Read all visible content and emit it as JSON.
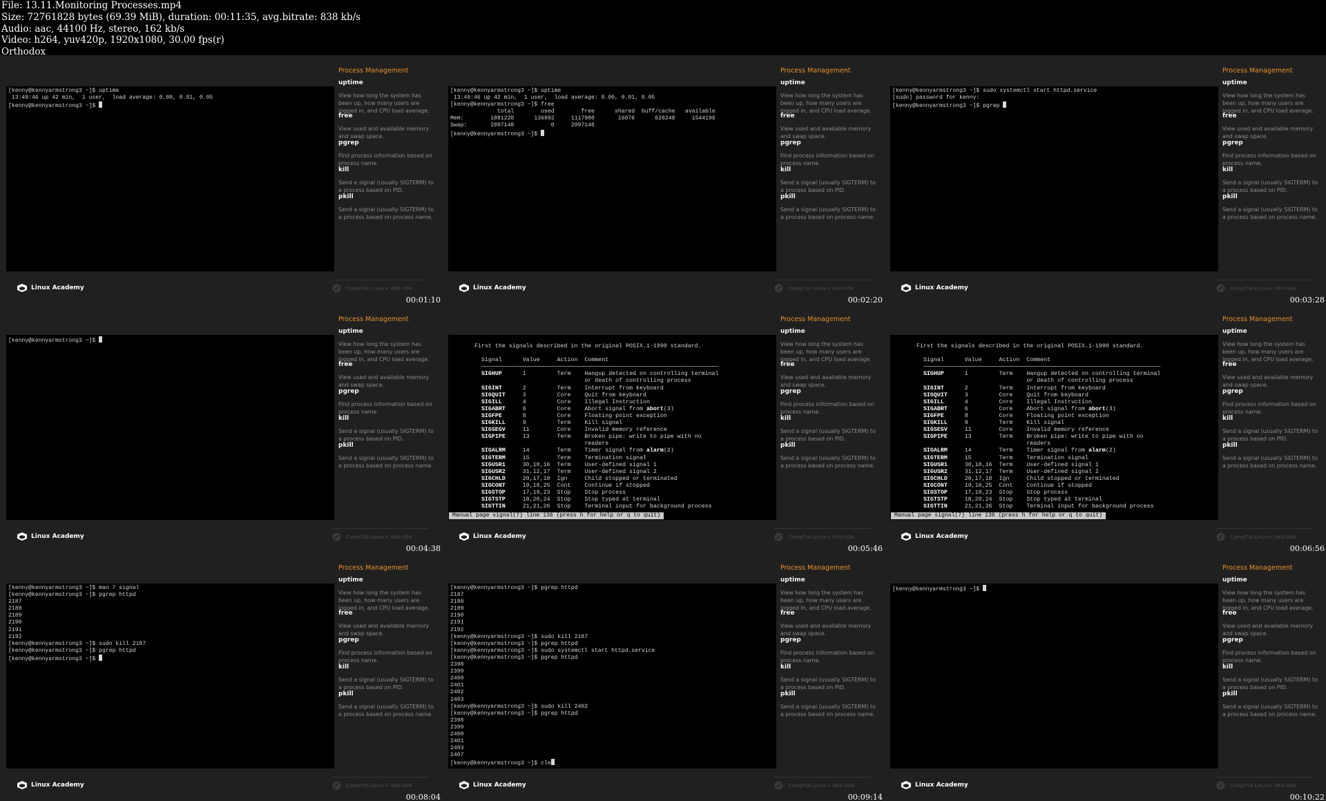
{
  "header": {
    "lines": [
      "File: 13.11.Monitoring Processes.mp4",
      "Size: 72761828 bytes (69.39 MiB), duration: 00:11:35, avg.bitrate: 838 kb/s",
      "Audio: aac, 44100 Hz, stereo, 162 kb/s",
      "Video: h264, yuv420p, 1920x1080, 30.00 fps(r)",
      "Orthodox"
    ]
  },
  "sidebar": {
    "title": "Process Management",
    "items": [
      {
        "name": "uptime",
        "desc": "View how long the system has been up, how many users are logged in, and CPU load average."
      },
      {
        "name": "free",
        "desc": "View used and available memory and swap space."
      },
      {
        "name": "pgrep",
        "desc": "Find process information based on process name."
      },
      {
        "name": "kill",
        "desc": "Send a signal (usually SIGTERM) to a process based on PID."
      },
      {
        "name": "pkill",
        "desc": "Send a signal (usually SIGTERM) to a process based on process name."
      }
    ]
  },
  "footer": {
    "logo_text": "Linux Academy",
    "course_text": "CompTIA Linux+ XK0-004",
    "logo_icon": "linux-academy-cube-icon",
    "course_icon": "comptia-badge-icon"
  },
  "manpage": {
    "intro": "First the signals described in the original POSIX.1-1990 standard.",
    "header": [
      "Signal",
      "Value",
      "Action",
      "Comment"
    ],
    "rows": [
      [
        "SIGHUP",
        "1",
        "Term",
        "Hangup detected on controlling terminal"
      ],
      [
        "",
        "",
        "",
        "or death of controlling process"
      ],
      [
        "SIGINT",
        "2",
        "Term",
        "Interrupt from keyboard"
      ],
      [
        "SIGQUIT",
        "3",
        "Core",
        "Quit from keyboard"
      ],
      [
        "SIGILL",
        "4",
        "Core",
        "Illegal Instruction"
      ],
      [
        "SIGABRT",
        "6",
        "Core",
        "Abort signal from abort(3)"
      ],
      [
        "SIGFPE",
        "8",
        "Core",
        "Floating point exception"
      ],
      [
        "SIGKILL",
        "9",
        "Term",
        "Kill signal"
      ],
      [
        "SIGSEGV",
        "11",
        "Core",
        "Invalid memory reference"
      ],
      [
        "SIGPIPE",
        "13",
        "Term",
        "Broken pipe: write to pipe with no"
      ],
      [
        "",
        "",
        "",
        "readers"
      ],
      [
        "SIGALRM",
        "14",
        "Term",
        "Timer signal from alarm(2)"
      ],
      [
        "SIGTERM",
        "15",
        "Term",
        "Termination signal"
      ],
      [
        "SIGUSR1",
        "30,10,16",
        "Term",
        "User-defined signal 1"
      ],
      [
        "SIGUSR2",
        "31,12,17",
        "Term",
        "User-defined signal 2"
      ],
      [
        "SIGCHLD",
        "20,17,18",
        "Ign",
        "Child stopped or terminated"
      ],
      [
        "SIGCONT",
        "19,18,25",
        "Cont",
        "Continue if stopped"
      ],
      [
        "SIGSTOP",
        "17,19,23",
        "Stop",
        "Stop process"
      ],
      [
        "SIGTSTP",
        "18,20,24",
        "Stop",
        "Stop typed at terminal"
      ],
      [
        "SIGTTIN",
        "21,21,26",
        "Stop",
        "Terminal input for background process"
      ]
    ],
    "status": "Manual page signal(7) line 136 (press h for help or q to quit)"
  },
  "thumbnails": [
    {
      "timestamp": "00:01:10",
      "terminal": "[kenny@kennyarmstrong3 ~]$ uptime\n 13:49:46 up 42 min,  1 user,  load average: 0.00, 0.01, 0.05\n[kenny@kennyarmstrong3 ~]$ "
    },
    {
      "timestamp": "00:02:20",
      "terminal": "[kenny@kennyarmstrong3 ~]$ uptime\n 13:49:46 up 42 min,  1 user,  load average: 0.00, 0.01, 0.05\n[kenny@kennyarmstrong3 ~]$ free\n              total        used        free      shared  buff/cache   available\nMem:        1881220      136992     1117980       16876      626248     1544196\nSwap:       2097148           0     2097148\n[kenny@kennyarmstrong3 ~]$ "
    },
    {
      "timestamp": "00:03:28",
      "terminal": "[kenny@kennyarmstrong3 ~]$ sudo systemctl start httpd.service\n[sudo] password for kenny:\n[kenny@kennyarmstrong3 ~]$ pgrep "
    },
    {
      "timestamp": "00:04:38",
      "terminal": "[kenny@kennyarmstrong3 ~]$ "
    },
    {
      "timestamp": "00:05:46",
      "terminal": ""
    },
    {
      "timestamp": "00:06:56",
      "terminal": ""
    },
    {
      "timestamp": "00:08:04",
      "terminal": "[kenny@kennyarmstrong3 ~]$ man 7 signal\n[kenny@kennyarmstrong3 ~]$ pgrep httpd\n2187\n2188\n2189\n2190\n2191\n2192\n[kenny@kennyarmstrong3 ~]$ sudo kill 2187\n[kenny@kennyarmstrong3 ~]$ pgrep httpd\n[kenny@kennyarmstrong3 ~]$ "
    },
    {
      "timestamp": "00:09:14",
      "terminal": "[kenny@kennyarmstrong3 ~]$ pgrep httpd\n2187\n2188\n2189\n2190\n2191\n2192\n[kenny@kennyarmstrong3 ~]$ sudo kill 2187\n[kenny@kennyarmstrong3 ~]$ pgrep httpd\n[kenny@kennyarmstrong3 ~]$ sudo systemctl start httpd.service\n[kenny@kennyarmstrong3 ~]$ pgrep httpd\n2398\n2399\n2400\n2401\n2402\n2403\n[kenny@kennyarmstrong3 ~]$ sudo kill 2402\n[kenny@kennyarmstrong3 ~]$ pgrep httpd\n2398\n2399\n2400\n2401\n2403\n2407\n[kenny@kennyarmstrong3 ~]$ cle"
    },
    {
      "timestamp": "00:10:22",
      "terminal": "[kenny@kennyarmstrong3 ~]$ "
    }
  ],
  "colors": {
    "accent": "#e8912c",
    "panel": "#202020",
    "terminal": "#000000"
  }
}
